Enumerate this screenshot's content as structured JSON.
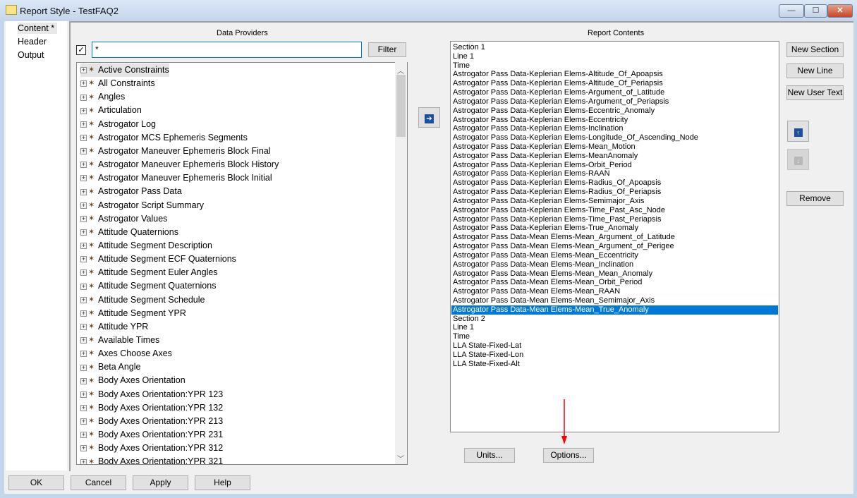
{
  "window": {
    "title": "Report Style - TestFAQ2",
    "minimize": "—",
    "maximize": "☐",
    "close": "✕"
  },
  "nav": {
    "items": [
      "Content *",
      "Header",
      "Output"
    ]
  },
  "providers": {
    "heading": "Data Providers",
    "filter_value": "*",
    "filter_button": "Filter",
    "checked": true,
    "items": [
      "Active Constraints",
      "All Constraints",
      "Angles",
      "Articulation",
      "Astrogator Log",
      "Astrogator MCS Ephemeris Segments",
      "Astrogator Maneuver Ephemeris Block Final",
      "Astrogator Maneuver Ephemeris Block History",
      "Astrogator Maneuver Ephemeris Block Initial",
      "Astrogator Pass Data",
      "Astrogator Script Summary",
      "Astrogator Values",
      "Attitude Quaternions",
      "Attitude Segment Description",
      "Attitude Segment ECF Quaternions",
      "Attitude Segment Euler Angles",
      "Attitude Segment Quaternions",
      "Attitude Segment Schedule",
      "Attitude Segment YPR",
      "Attitude YPR",
      "Available Times",
      "Axes Choose Axes",
      "Beta Angle",
      "Body Axes Orientation",
      "Body Axes Orientation:YPR 123",
      "Body Axes Orientation:YPR 132",
      "Body Axes Orientation:YPR 213",
      "Body Axes Orientation:YPR 231",
      "Body Axes Orientation:YPR 312",
      "Body Axes Orientation:YPR 321"
    ]
  },
  "add_button": "➔",
  "contents": {
    "heading": "Report Contents",
    "selected_index": 29,
    "items": [
      "Section 1",
      "Line 1",
      "Time",
      "Astrogator Pass Data-Keplerian Elems-Altitude_Of_Apoapsis",
      "Astrogator Pass Data-Keplerian Elems-Altitude_Of_Periapsis",
      "Astrogator Pass Data-Keplerian Elems-Argument_of_Latitude",
      "Astrogator Pass Data-Keplerian Elems-Argument_of_Periapsis",
      "Astrogator Pass Data-Keplerian Elems-Eccentric_Anomaly",
      "Astrogator Pass Data-Keplerian Elems-Eccentricity",
      "Astrogator Pass Data-Keplerian Elems-Inclination",
      "Astrogator Pass Data-Keplerian Elems-Longitude_Of_Ascending_Node",
      "Astrogator Pass Data-Keplerian Elems-Mean_Motion",
      "Astrogator Pass Data-Keplerian Elems-MeanAnomaly",
      "Astrogator Pass Data-Keplerian Elems-Orbit_Period",
      "Astrogator Pass Data-Keplerian Elems-RAAN",
      "Astrogator Pass Data-Keplerian Elems-Radius_Of_Apoapsis",
      "Astrogator Pass Data-Keplerian Elems-Radius_Of_Periapsis",
      "Astrogator Pass Data-Keplerian Elems-Semimajor_Axis",
      "Astrogator Pass Data-Keplerian Elems-Time_Past_Asc_Node",
      "Astrogator Pass Data-Keplerian Elems-Time_Past_Periapsis",
      "Astrogator Pass Data-Keplerian Elems-True_Anomaly",
      "Astrogator Pass Data-Mean Elems-Mean_Argument_of_Latitude",
      "Astrogator Pass Data-Mean Elems-Mean_Argument_of_Perigee",
      "Astrogator Pass Data-Mean Elems-Mean_Eccentricity",
      "Astrogator Pass Data-Mean Elems-Mean_Inclination",
      "Astrogator Pass Data-Mean Elems-Mean_Mean_Anomaly",
      "Astrogator Pass Data-Mean Elems-Mean_Orbit_Period",
      "Astrogator Pass Data-Mean Elems-Mean_RAAN",
      "Astrogator Pass Data-Mean Elems-Mean_Semimajor_Axis",
      "Astrogator Pass Data-Mean Elems-Mean_True_Anomaly",
      "Section 2",
      "Line 1",
      "Time",
      "LLA State-Fixed-Lat",
      "LLA State-Fixed-Lon",
      "LLA State-Fixed-Alt"
    ]
  },
  "side_buttons": {
    "new_section": "New Section",
    "new_line": "New Line",
    "new_user_text": "New User Text",
    "move_up": "↑",
    "move_down": "↓",
    "remove": "Remove"
  },
  "lower_buttons": {
    "units": "Units...",
    "options": "Options..."
  },
  "footer": {
    "ok": "OK",
    "cancel": "Cancel",
    "apply": "Apply",
    "help": "Help"
  },
  "colors": {
    "selection": "#0078d7",
    "annotation_arrow": "#ff0000"
  }
}
